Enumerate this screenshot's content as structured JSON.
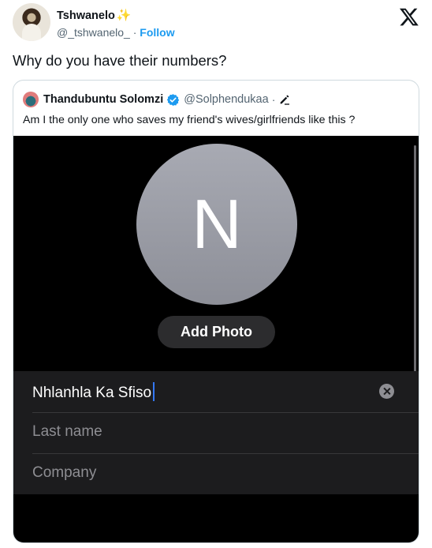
{
  "tweet": {
    "author_name": "Tshwanelo",
    "author_emoji": "✨",
    "author_handle": "@_tshwanelo_",
    "separator": "·",
    "follow_label": "Follow",
    "text": "Why do you have their numbers?"
  },
  "quote": {
    "author_name": "Thandubuntu Solomzi",
    "author_handle": "@Solphendukaa",
    "separator": "·",
    "text": "Am I the only one who saves my friend's wives/girlfriends like this ?"
  },
  "contact_screen": {
    "initial": "N",
    "add_photo_label": "Add Photo",
    "first_name_value": "Nhlanhla  Ka Sfiso",
    "last_name_placeholder": "Last name",
    "company_placeholder": "Company"
  },
  "icons": {
    "logo": "x-logo-icon",
    "verified": "verified-badge-icon",
    "edit": "edit-pencil-icon",
    "clear": "clear-field-icon"
  },
  "colors": {
    "accent": "#1d9bf0",
    "caret": "#3478f6",
    "contact_bg": "#000000",
    "field_bg": "#1c1c1e"
  }
}
